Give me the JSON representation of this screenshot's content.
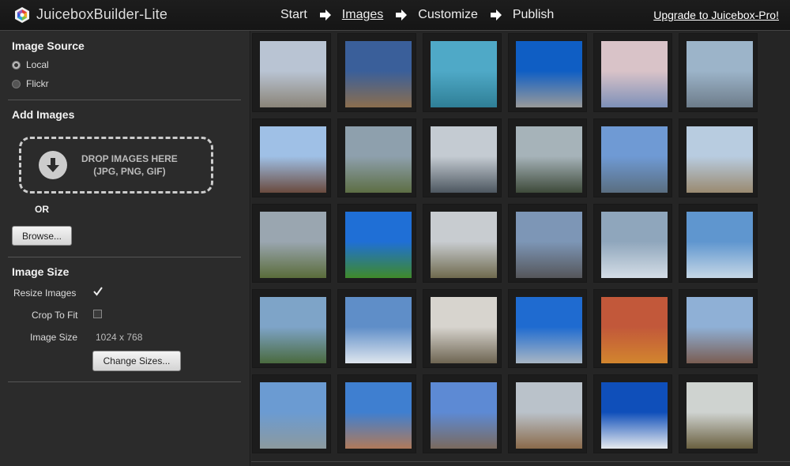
{
  "header": {
    "app_title": "JuiceboxBuilder-Lite",
    "steps": [
      {
        "label": "Start",
        "active": false
      },
      {
        "label": "Images",
        "active": true
      },
      {
        "label": "Customize",
        "active": false
      },
      {
        "label": "Publish",
        "active": false
      }
    ],
    "upgrade_link": "Upgrade to Juicebox-Pro!"
  },
  "sidebar": {
    "image_source": {
      "title": "Image Source",
      "options": [
        {
          "label": "Local",
          "selected": true
        },
        {
          "label": "Flickr",
          "selected": false
        }
      ]
    },
    "add_images": {
      "title": "Add Images",
      "drop_line1": "DROP IMAGES HERE",
      "drop_line2": "(JPG, PNG, GIF)",
      "or_label": "OR",
      "browse_button": "Browse..."
    },
    "image_size": {
      "title": "Image Size",
      "resize_label": "Resize Images",
      "resize_checked": true,
      "crop_label": "Crop To Fit",
      "crop_checked": false,
      "size_label": "Image Size",
      "size_value": "1024 x 768",
      "change_button": "Change Sizes..."
    }
  },
  "colors": {
    "background": "#2a2a2a",
    "topbar": "#1a1a1a",
    "thumb_frame": "#1c1c1c"
  },
  "thumbnails": [
    {
      "scene": "street-sun",
      "c1": "#b9c4d3",
      "c2": "#8a8478"
    },
    {
      "scene": "salt-flat-cloud",
      "c1": "#3a5f9a",
      "c2": "#8b6e4e"
    },
    {
      "scene": "flamingos",
      "c1": "#4fa9c7",
      "c2": "#2f7f96"
    },
    {
      "scene": "beach-blue",
      "c1": "#0f5ec4",
      "c2": "#9a9a9a"
    },
    {
      "scene": "calm-lake-dusk",
      "c1": "#d9c3c8",
      "c2": "#7d90b8"
    },
    {
      "scene": "lake-birds",
      "c1": "#9cb4c9",
      "c2": "#6d7c8a"
    },
    {
      "scene": "harbor-houses",
      "c1": "#9fc0e6",
      "c2": "#6a4a3e"
    },
    {
      "scene": "machu-picchu",
      "c1": "#8ea0ad",
      "c2": "#5d6e44"
    },
    {
      "scene": "mountain-clouds",
      "c1": "#c4cbd2",
      "c2": "#4d5760"
    },
    {
      "scene": "foggy-peak",
      "c1": "#a6b3b9",
      "c2": "#3e4a3a"
    },
    {
      "scene": "seaside-town",
      "c1": "#6f9ad4",
      "c2": "#5a6e80"
    },
    {
      "scene": "rocks-beach",
      "c1": "#b8cce0",
      "c2": "#9a8a70"
    },
    {
      "scene": "ruins-clouds",
      "c1": "#9aa6b0",
      "c2": "#5a6c3a"
    },
    {
      "scene": "green-field",
      "c1": "#1f6fd6",
      "c2": "#3f8a2a"
    },
    {
      "scene": "bare-tree",
      "c1": "#c8ccd0",
      "c2": "#6f6a4e"
    },
    {
      "scene": "church-lake",
      "c1": "#7d96b6",
      "c2": "#55565a"
    },
    {
      "scene": "snow-road",
      "c1": "#8fa6bc",
      "c2": "#d4dde6"
    },
    {
      "scene": "snowy-lake",
      "c1": "#5f96cf",
      "c2": "#c6d7e6"
    },
    {
      "scene": "coast-sky",
      "c1": "#7ea4c8",
      "c2": "#4a6a3e"
    },
    {
      "scene": "winter-tree",
      "c1": "#5f8ec8",
      "c2": "#dfe6ee"
    },
    {
      "scene": "forest-path",
      "c1": "#d7d4ce",
      "c2": "#6e6552"
    },
    {
      "scene": "airplane-wing",
      "c1": "#1f6bd0",
      "c2": "#a8b6c4"
    },
    {
      "scene": "sunset-fields",
      "c1": "#c2583a",
      "c2": "#d2852e"
    },
    {
      "scene": "town-street",
      "c1": "#8fb0d6",
      "c2": "#7a5d52"
    },
    {
      "scene": "cemetery",
      "c1": "#6b9bd2",
      "c2": "#8c9a9e"
    },
    {
      "scene": "city-view",
      "c1": "#3f7fd0",
      "c2": "#b07a5a"
    },
    {
      "scene": "city-buildings",
      "c1": "#5d8ad4",
      "c2": "#7a6a5e"
    },
    {
      "scene": "foggy-cabin",
      "c1": "#bac2ca",
      "c2": "#8a6a4a"
    },
    {
      "scene": "cactus-salt",
      "c1": "#0f4fba",
      "c2": "#e6eaee"
    },
    {
      "scene": "harbor-dawn",
      "c1": "#cfd3d0",
      "c2": "#6a6040"
    }
  ]
}
